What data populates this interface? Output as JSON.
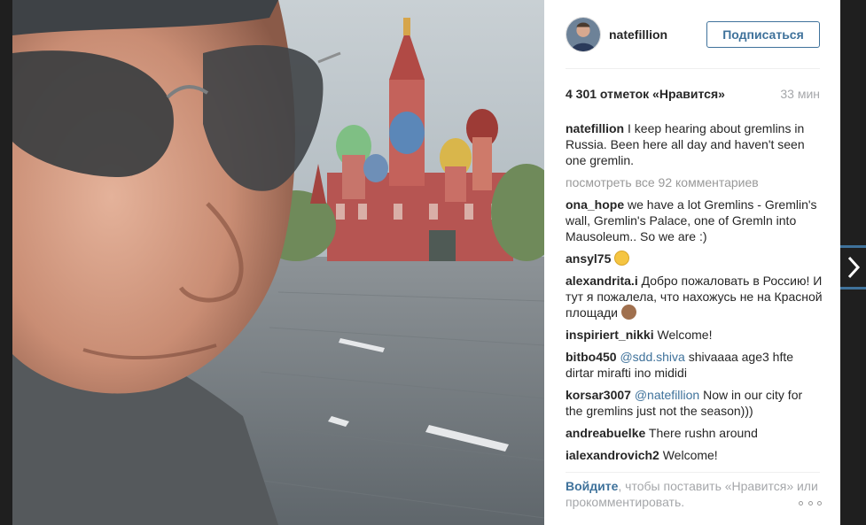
{
  "post": {
    "username": "natefillion",
    "follow_label": "Подписаться",
    "likes": "4 301 отметок «Нравится»",
    "time": "33 мин"
  },
  "comments": {
    "caption": {
      "user": "natefillion",
      "text": "I keep hearing about gremlins in Russia. Been here all day and haven't seen one gremlin."
    },
    "view_all": "посмотреть все 92 комментариев",
    "items": [
      {
        "user": "ona_hope",
        "text": "we have a lot Gremlins - Gremlin's wall, Gremlin's Palace, one of Gremln into Mausoleum.. So we are :)"
      },
      {
        "user": "ansyl75",
        "text": ""
      },
      {
        "user": "alexandrita.i",
        "text": "Добро пожаловать в Россию! И тут я пожалела, что нахожусь не на Красной площади"
      },
      {
        "user": "inspiriert_nikki",
        "text": "Welcome!"
      },
      {
        "user": "bitbo450",
        "mention": "@sdd.shiva",
        "text": "shivaaaa age3 hfte dirtar mirafti ino mididi"
      },
      {
        "user": "korsar3007",
        "mention": "@natefillion",
        "text": "Now in our city for the gremlins just not the season)))"
      },
      {
        "user": "andreabuelke",
        "text": "There rushn around"
      },
      {
        "user": "ialexandrovich2",
        "text": "Welcome!"
      }
    ]
  },
  "footer": {
    "login_link": "Войдите",
    "login_text": ", чтобы поставить «Нравится» или прокомментировать."
  },
  "icons": {
    "more": "more-options-icon",
    "next": "chevron-right-icon"
  },
  "colors": {
    "link": "#3f729b",
    "muted": "#a5a7aa"
  }
}
